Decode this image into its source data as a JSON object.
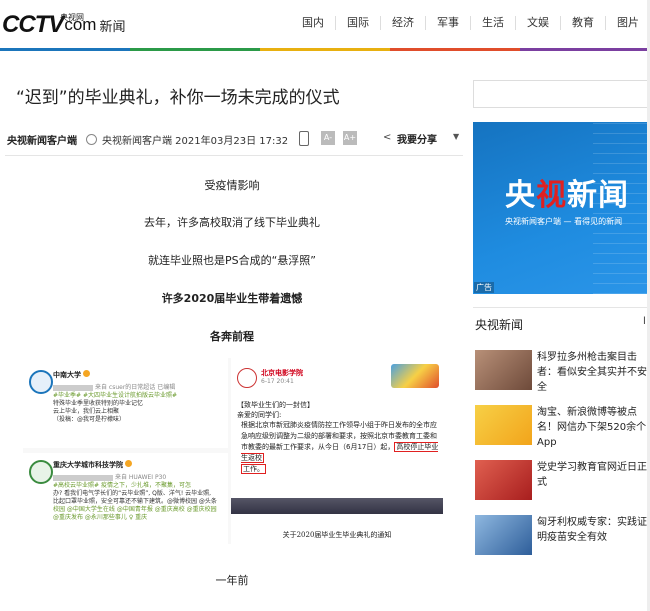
{
  "header": {
    "logo": {
      "cctv": "CCTV",
      "com": "com",
      "cn": "新闻",
      "small": "央视网"
    },
    "nav": [
      "国内",
      "国际",
      "经济",
      "军事",
      "生活",
      "文娱",
      "教育",
      "图片"
    ]
  },
  "article": {
    "title": "“迟到”的毕业典礼，补你一场未完成的仪式",
    "source": "央视新闻客户端",
    "meta": "央视新闻客户端 2021年03月23日 17:32",
    "font_small": "A-",
    "font_large": "A+",
    "share": "我要分享",
    "paragraphs": [
      "受疫情影响",
      "去年，许多高校取消了线下毕业典礼",
      "就连毕业照也是PS合成的“悬浮照”",
      "许多2020届毕业生带着遗憾",
      "各奔前程",
      "一年前"
    ],
    "image": {
      "post1": {
        "name": "中南大学",
        "from": "来自 csuer的日常超话 已编辑",
        "lines": [
          "#毕业季# #大四毕业生设计航拍版云毕业照#",
          "特殊毕业季里收获特别的毕业记忆",
          "云上毕业，我们云上相聚",
          "（投稿：@我可是柠檬味）"
        ]
      },
      "post2": {
        "name": "重庆大学城市科技学院",
        "from": "来自 HUAWEI P30",
        "lines": [
          "#高校云毕业照# 疫情之下，少扎堆，不聚集，可怎",
          "办? 看我们电气学长们的“云毕业照”, Q版、洋气! 云毕业照,",
          "比起口罩毕业照，安全可靠还不输下建筑。@微博校园 @头条",
          "校园 @中国大学生在线 @中国青年报 @重庆高校 @重庆校园",
          "@重庆发布 @永川那些事儿 ♀ 重庆"
        ]
      },
      "letter": {
        "name": "北京电影学院",
        "date": "6-17 20:41",
        "heading": "【致毕业生们的一封信】",
        "greeting": "亲爱的同学们:",
        "body1": "根据北京市新冠肺炎疫情防控工作领导小组于昨日发布的全市应急响应级别调整为二级的部署和要求，按照北京市委教育工委和市教委的最新工作要求，从今日（6月17日）起，",
        "highlight1": "高校停止毕业生返校",
        "highlight2": "工作。",
        "caption": "关于2020届毕业生毕业典礼的通知"
      }
    }
  },
  "sidebar": {
    "ad": {
      "title_a": "央",
      "title_b": "视",
      "title_c": "新闻",
      "sub": "央视新闻客户端 — 看得见的新闻",
      "tag": "广告"
    },
    "section_title": "央视新闻",
    "news": [
      {
        "text": "科罗拉多州枪击案目击者：看似安全其实并不安全",
        "color": "#9a6a50"
      },
      {
        "text": "淘宝、新浪微博等被点名！网信办下架520余个App",
        "color": "#f2b21b"
      },
      {
        "text": "党史学习教育官网近日正式",
        "color": "#c8322a"
      },
      {
        "text": "匈牙利权威专家：实践证明疫苗安全有效",
        "color": "#3a78b8"
      }
    ]
  }
}
